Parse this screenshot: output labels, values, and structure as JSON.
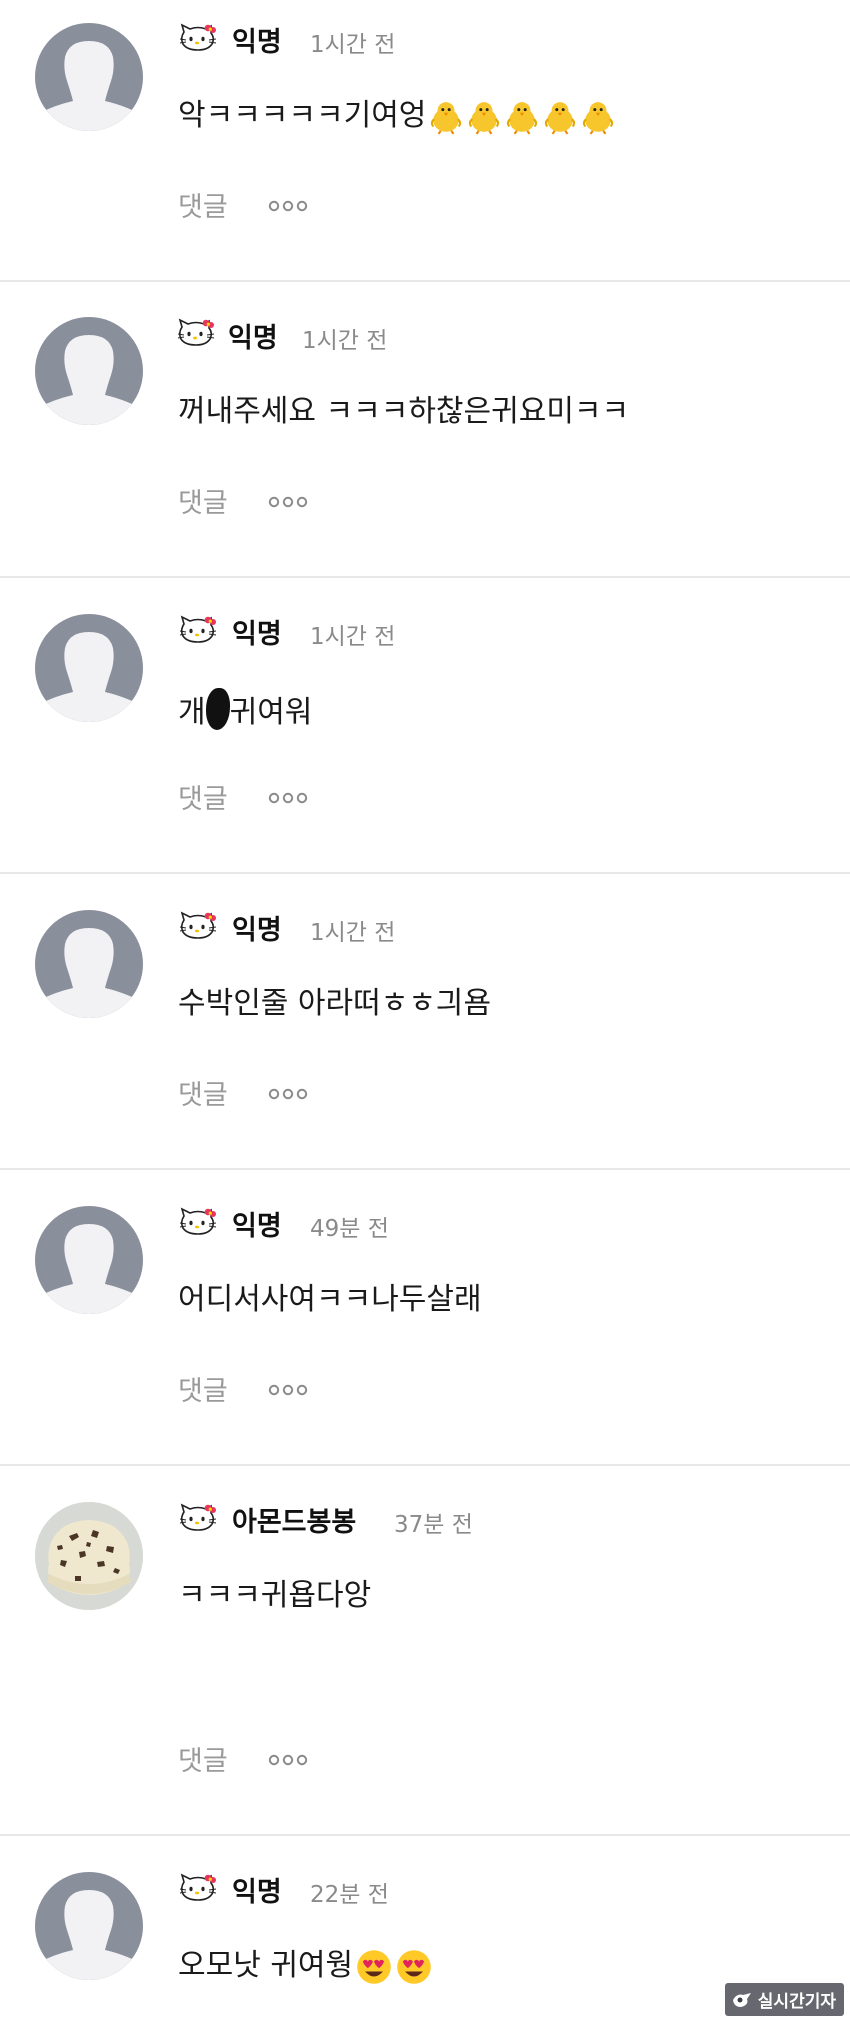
{
  "comments": [
    {
      "author": "익명",
      "time": "1시간 전",
      "text": "악ㅋㅋㅋㅋㅋ기여엉",
      "emoji": "chick",
      "emoji_count": 5,
      "avatar": "default",
      "reply": "댓글"
    },
    {
      "author": "익명",
      "time": "1시간 전",
      "text": "꺼내주세요 ㅋㅋㅋ하찮은귀요미ㅋㅋ",
      "avatar": "default",
      "reply": "댓글"
    },
    {
      "author": "익명",
      "time": "1시간 전",
      "text_before": "개",
      "text_after": "귀여워",
      "censored": true,
      "avatar": "default",
      "reply": "댓글"
    },
    {
      "author": "익명",
      "time": "1시간 전",
      "text": "수박인줄 아라떠ㅎㅎ긔욤",
      "avatar": "default",
      "reply": "댓글"
    },
    {
      "author": "익명",
      "time": "49분 전",
      "text": "어디서사여ㅋㅋ나두살래",
      "avatar": "default",
      "reply": "댓글"
    },
    {
      "author": "아몬드봉봉",
      "time": "37분 전",
      "text": "ㅋㅋㅋ귀욥다앙",
      "avatar": "ice-cream",
      "reply": "댓글"
    },
    {
      "author": "익명",
      "time": "22분 전",
      "text": "오모낫 귀여웡",
      "emoji": "heart-eyes",
      "emoji_count": 2,
      "avatar": "default",
      "reply": ""
    }
  ],
  "watermark": {
    "text": "실시간기자"
  },
  "icons": {
    "badge": "hello-kitty-icon",
    "more": "more-dots-icon"
  },
  "colors": {
    "divider": "#e8e8e8",
    "time": "#8a8a8a",
    "reply": "#9a9a9a",
    "avatar_bg": "#ededf1",
    "avatar_fg": "#8a8f9c"
  }
}
